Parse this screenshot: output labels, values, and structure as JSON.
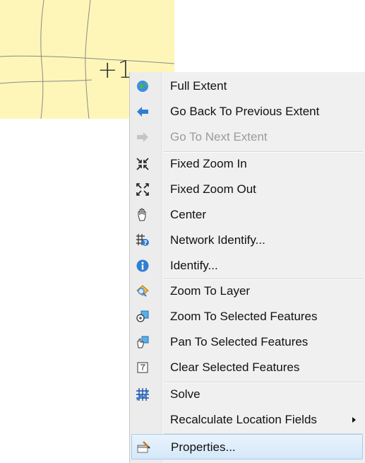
{
  "map": {
    "background_color": "#fdf6b8",
    "cursor_text": "+1"
  },
  "context_menu": {
    "items": [
      {
        "label": "Full Extent",
        "icon": "globe-icon",
        "enabled": true
      },
      {
        "label": "Go Back To Previous Extent",
        "icon": "back-arrow-icon",
        "enabled": true
      },
      {
        "label": "Go To Next Extent",
        "icon": "forward-arrow-icon",
        "enabled": false
      },
      {
        "label": "Fixed Zoom In",
        "icon": "fixed-zoom-in-icon",
        "enabled": true
      },
      {
        "label": "Fixed Zoom Out",
        "icon": "fixed-zoom-out-icon",
        "enabled": true
      },
      {
        "label": "Center",
        "icon": "hand-pan-icon",
        "enabled": true
      },
      {
        "label": "Network Identify...",
        "icon": "network-identify-icon",
        "enabled": true
      },
      {
        "label": "Identify...",
        "icon": "info-icon",
        "enabled": true
      },
      {
        "label": "Zoom To Layer",
        "icon": "zoom-to-layer-icon",
        "enabled": true
      },
      {
        "label": "Zoom To Selected Features",
        "icon": "zoom-to-selected-icon",
        "enabled": true
      },
      {
        "label": "Pan To Selected Features",
        "icon": "pan-to-selected-icon",
        "enabled": true
      },
      {
        "label": "Clear Selected Features",
        "icon": "clear-selection-icon",
        "enabled": true
      },
      {
        "label": "Solve",
        "icon": "solve-grid-icon",
        "enabled": true
      },
      {
        "label": "Recalculate Location Fields",
        "icon": "",
        "enabled": true,
        "has_submenu": true
      },
      {
        "label": "Properties...",
        "icon": "properties-icon",
        "enabled": true,
        "highlighted": true
      }
    ]
  },
  "colors": {
    "menu_background": "#f0f0f0",
    "highlight": "#d5e8f9",
    "disabled_text": "#9b9b9b"
  }
}
